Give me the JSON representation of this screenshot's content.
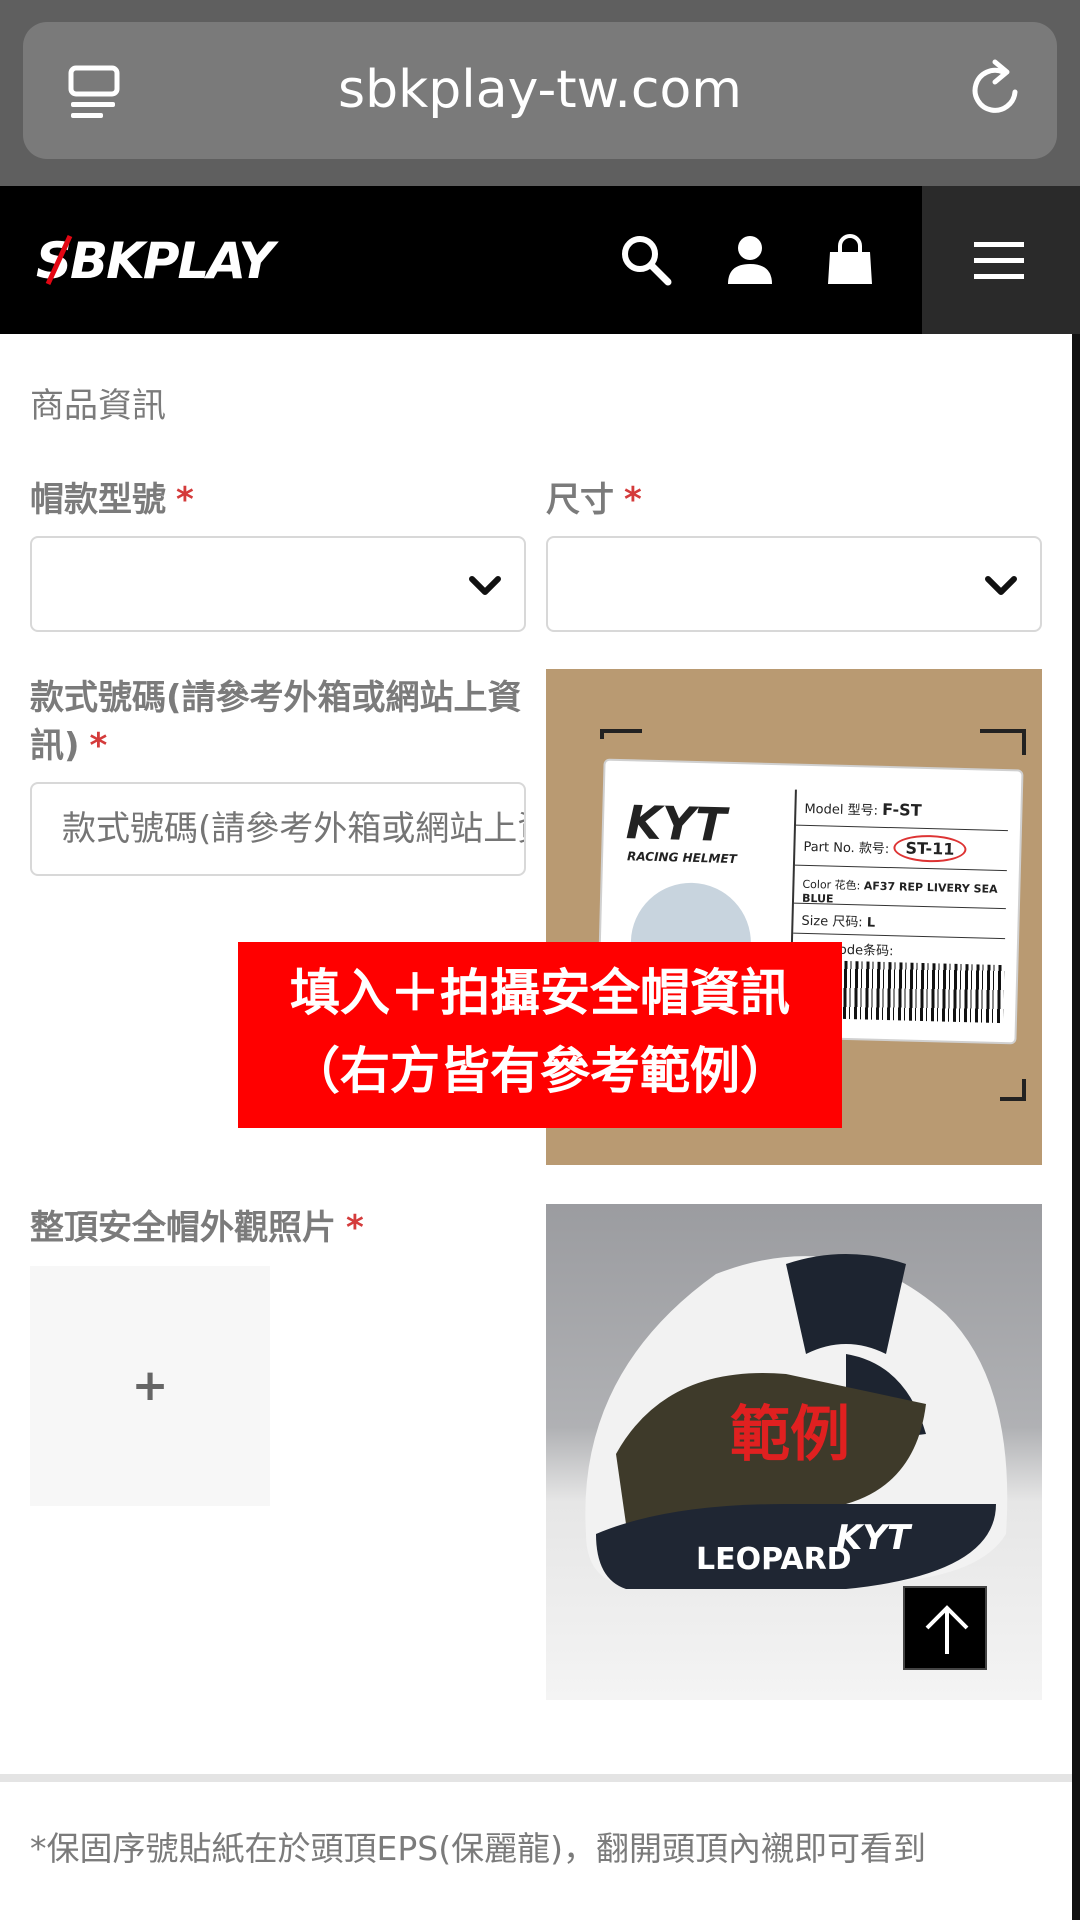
{
  "browser": {
    "url": "sbkplay-tw.com",
    "reader_icon": "reader-icon",
    "reload_icon": "reload-icon"
  },
  "header": {
    "logo_text": "SBKPLAY",
    "icons": [
      "search-icon",
      "user-icon",
      "cart-icon",
      "menu-icon"
    ]
  },
  "form": {
    "section_title": "商品資訊",
    "model_label": "帽款型號",
    "size_label": "尺寸",
    "style_code_label": "款式號碼(請參考外箱或網站上資訊)",
    "style_code_placeholder": "款式號碼(請參考外箱或網站上資訊)",
    "photo_label": "整頂安全帽外觀照片",
    "required_mark": "*",
    "upload_plus": "+"
  },
  "box_label_example": {
    "brand": "KYT",
    "brand_sub": "RACING HELMET",
    "model_key": "Model 型号:",
    "model_value": "F-ST",
    "part_key": "Part No. 款号:",
    "part_value": "ST-11",
    "color_key": "Color 花色:",
    "color_value": "AF37 REP LIVERY SEA BLUE",
    "size_key": "Size 尺码:",
    "size_value": "L",
    "ean_key": "EAN code条码:"
  },
  "overlay": {
    "line1": "填入＋拍攝安全帽資訊",
    "line2": "（右方皆有參考範例）"
  },
  "helmet_example": {
    "label": "範例",
    "decal_text": "LEOPARD",
    "brand": "KYT"
  },
  "note": "*保固序號貼紙在於頭頂EPS(保麗龍)，翻開頭頂內襯即可看到",
  "colors": {
    "required": "#d43b3b",
    "overlay_bg": "#ff0000",
    "header_bg": "#000000"
  }
}
